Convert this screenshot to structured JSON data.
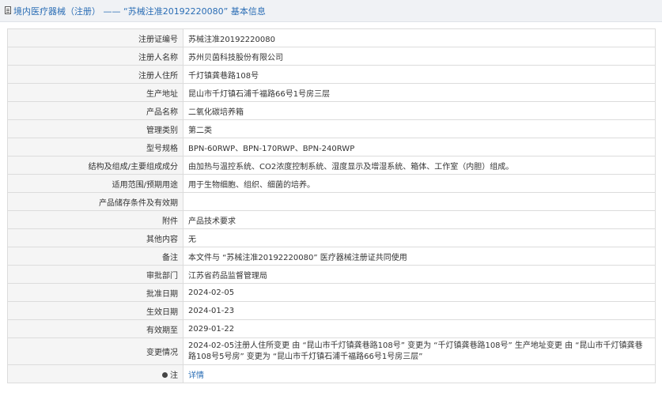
{
  "header": {
    "title": "境内医疗器械（注册） —— “苏械注准20192220080” 基本信息",
    "icon": "document-icon"
  },
  "rows": [
    {
      "label": "注册证编号",
      "value": "苏械注准20192220080"
    },
    {
      "label": "注册人名称",
      "value": "苏州贝茵科技股份有限公司"
    },
    {
      "label": "注册人住所",
      "value": "千灯镇龚巷路108号"
    },
    {
      "label": "生产地址",
      "value": "昆山市千灯镇石浦千福路66号1号房三层"
    },
    {
      "label": "产品名称",
      "value": "二氧化碳培养箱"
    },
    {
      "label": "管理类别",
      "value": "第二类"
    },
    {
      "label": "型号规格",
      "value": "BPN-60RWP、BPN-170RWP、BPN-240RWP"
    },
    {
      "label": "结构及组成/主要组成成分",
      "value": "由加热与温控系统、CO2浓度控制系统、湿度显示及增湿系统、箱体、工作室（内胆）组成。"
    },
    {
      "label": "适用范围/预期用途",
      "value": "用于生物细胞、组织、细菌的培养。"
    },
    {
      "label": "产品储存条件及有效期",
      "value": ""
    },
    {
      "label": "附件",
      "value": "产品技术要求"
    },
    {
      "label": "其他内容",
      "value": "无"
    },
    {
      "label": "备注",
      "value": "本文件与 “苏械注准20192220080” 医疗器械注册证共同使用"
    },
    {
      "label": "审批部门",
      "value": "江苏省药品监督管理局"
    },
    {
      "label": "批准日期",
      "value": "2024-02-05"
    },
    {
      "label": "生效日期",
      "value": "2024-01-23"
    },
    {
      "label": "有效期至",
      "value": "2029-01-22"
    }
  ],
  "change_row": {
    "label": "变更情况",
    "value": "2024-02-05注册人住所变更 由 “昆山市千灯镇龚巷路108号” 变更为 “千灯镇龚巷路108号” 生产地址变更 由 “昆山市千灯镇龚巷路108号5号房” 变更为 “昆山市千灯镇石浦千福路66号1号房三层”"
  },
  "detail_row": {
    "label_icon": "bulb-icon",
    "label": "注",
    "link": "详情"
  }
}
